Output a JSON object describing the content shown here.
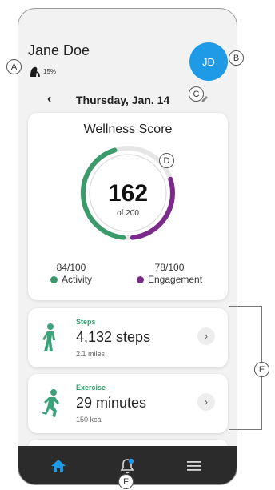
{
  "user": {
    "name": "Jane Doe",
    "hearing_level": "15%",
    "avatar_initials": "JD"
  },
  "date_nav": {
    "date_label": "Thursday, Jan. 14"
  },
  "wellness": {
    "title": "Wellness Score",
    "score": "162",
    "of_label": "of 200",
    "score_fraction": 0.81,
    "activity": {
      "value": "84/100",
      "label": "Activity",
      "color": "#3a9a6a",
      "fraction": 0.84
    },
    "engagement": {
      "value": "78/100",
      "label": "Engagement",
      "color": "#7b2a8c",
      "fraction": 0.78
    }
  },
  "stats": [
    {
      "category": "Steps",
      "main": "4,132 steps",
      "sub": "2.1 miles",
      "icon": "walking-person-icon"
    },
    {
      "category": "Exercise",
      "main": "29 minutes",
      "sub": "150 kcal",
      "icon": "running-person-icon"
    }
  ],
  "nav": {
    "items": [
      "home-icon",
      "notification-bell-icon",
      "menu-icon"
    ],
    "active_color": "#1e9ae6"
  },
  "callouts": {
    "a": "A",
    "b": "B",
    "c": "C",
    "d": "D",
    "e": "E",
    "f": "F"
  }
}
